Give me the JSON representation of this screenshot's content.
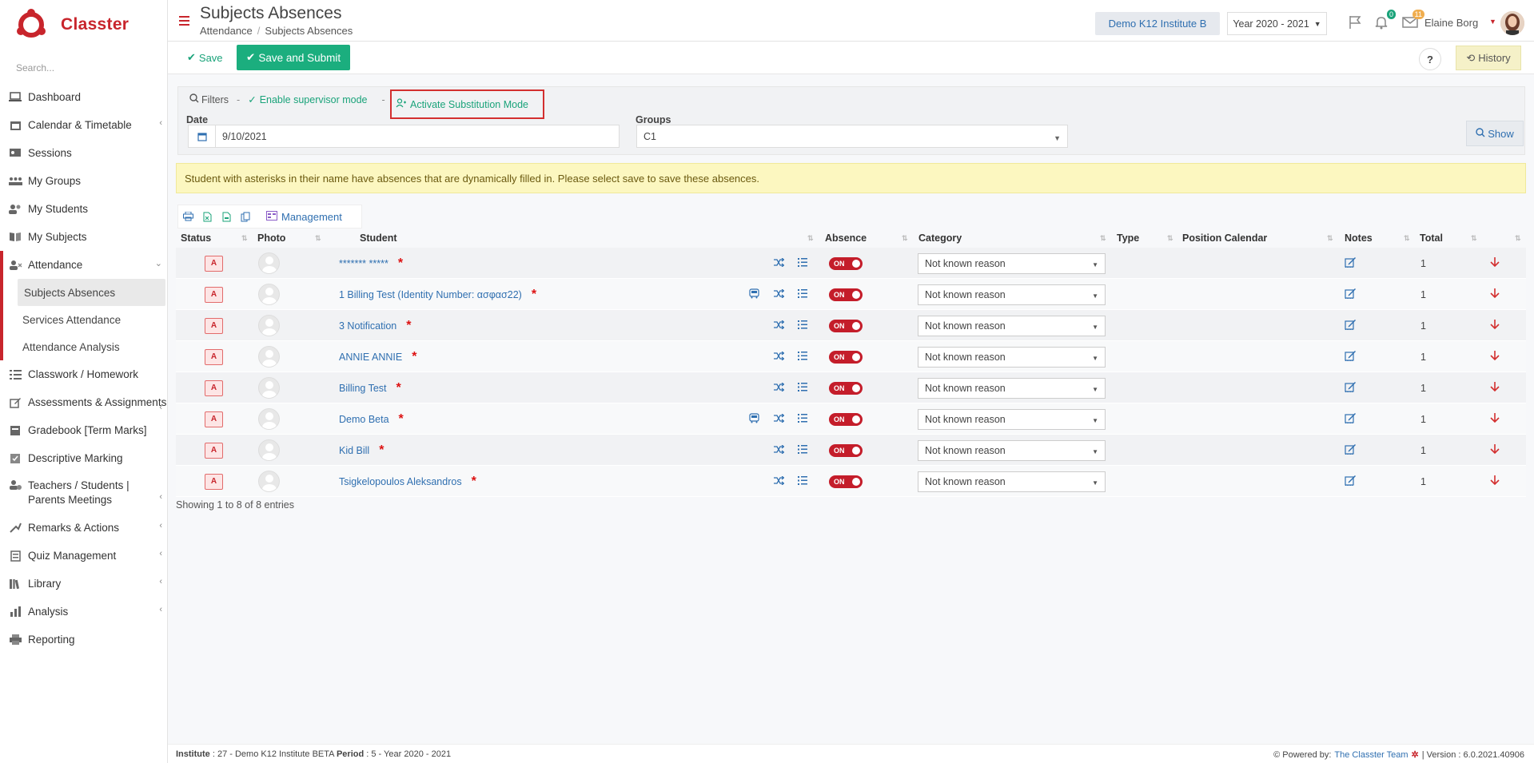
{
  "brand": {
    "name": "Classter",
    "color": "#c8252c"
  },
  "sidebar": {
    "search_placeholder": "Search...",
    "items": [
      {
        "label": "Dashboard",
        "icon": "laptop-icon"
      },
      {
        "label": "Calendar & Timetable",
        "icon": "calendar-icon"
      },
      {
        "label": "Sessions",
        "icon": "sessions-icon"
      },
      {
        "label": "My Groups",
        "icon": "groups-icon"
      },
      {
        "label": "My Students",
        "icon": "students-icon"
      },
      {
        "label": "My Subjects",
        "icon": "book-icon"
      },
      {
        "label": "Attendance",
        "icon": "attendance-icon"
      },
      {
        "label": "Classwork / Homework",
        "icon": "list-icon"
      },
      {
        "label": "Assessments & Assignments",
        "icon": "edit-icon"
      },
      {
        "label": "Gradebook [Term Marks]",
        "icon": "gradebook-icon"
      },
      {
        "label": "Descriptive Marking",
        "icon": "marking-icon"
      },
      {
        "label": "Teachers / Students | Parents Meetings",
        "icon": "meeting-icon"
      },
      {
        "label": "Remarks & Actions",
        "icon": "remarks-icon"
      },
      {
        "label": "Quiz Management",
        "icon": "quiz-icon"
      },
      {
        "label": "Library",
        "icon": "library-icon"
      },
      {
        "label": "Analysis",
        "icon": "analysis-icon"
      },
      {
        "label": "Reporting",
        "icon": "print-icon"
      }
    ],
    "attendance_sub": [
      "Subjects Absences",
      "Services Attendance",
      "Attendance Analysis"
    ]
  },
  "header": {
    "title": "Subjects Absences",
    "breadcrumb": [
      "Attendance",
      "Subjects Absences"
    ],
    "institute": "Demo K12 Institute B",
    "year": "Year 2020 - 2021",
    "notifications_count": "0",
    "messages_count": "11",
    "user": "Elaine Borg"
  },
  "toolbar": {
    "save": "Save",
    "save_submit": "Save and Submit",
    "help": "?",
    "history": "History"
  },
  "filters": {
    "label": "Filters",
    "supervisor": "Enable supervisor mode",
    "substitution": "Activate Substitution Mode",
    "date_label": "Date",
    "date_value": "9/10/2021",
    "groups_label": "Groups",
    "groups_value": "C1",
    "show": "Show"
  },
  "notice": "Student with asterisks in their name have absences that are dynamically filled in. Please select save to save these absences.",
  "tools": {
    "management": "Management"
  },
  "table": {
    "columns": [
      "Status",
      "Photo",
      "Student",
      "Absence",
      "Category",
      "Type",
      "Position Calendar",
      "Notes",
      "Total"
    ],
    "rows": [
      {
        "status": "A",
        "student": "******* *****",
        "bus": false,
        "absence": "ON",
        "category": "Not known reason",
        "total": "1"
      },
      {
        "status": "A",
        "student": "1 Billing Test (Identity Number: ασφασ22)",
        "bus": true,
        "absence": "ON",
        "category": "Not known reason",
        "total": "1"
      },
      {
        "status": "A",
        "student": "3 Notification",
        "bus": false,
        "absence": "ON",
        "category": "Not known reason",
        "total": "1"
      },
      {
        "status": "A",
        "student": "ANNIE ANNIE",
        "bus": false,
        "absence": "ON",
        "category": "Not known reason",
        "total": "1"
      },
      {
        "status": "A",
        "student": "Billing Test",
        "bus": false,
        "absence": "ON",
        "category": "Not known reason",
        "total": "1"
      },
      {
        "status": "A",
        "student": "Demo Beta",
        "bus": true,
        "absence": "ON",
        "category": "Not known reason",
        "total": "1"
      },
      {
        "status": "A",
        "student": "Kid Bill",
        "bus": false,
        "absence": "ON",
        "category": "Not known reason",
        "total": "1"
      },
      {
        "status": "A",
        "student": "Tsigkelopoulos Aleksandros",
        "bus": false,
        "absence": "ON",
        "category": "Not known reason",
        "total": "1"
      }
    ],
    "showing": "Showing 1 to 8 of 8 entries"
  },
  "footer": {
    "institute_label": "Institute",
    "institute_value": ": 27 - Demo K12 Institute BETA",
    "period_label": "Period",
    "period_value": ": 5 - Year 2020 - 2021",
    "powered": "Powered by:",
    "team": "The Classter Team",
    "version": "| Version : 6.0.2021.40906"
  }
}
